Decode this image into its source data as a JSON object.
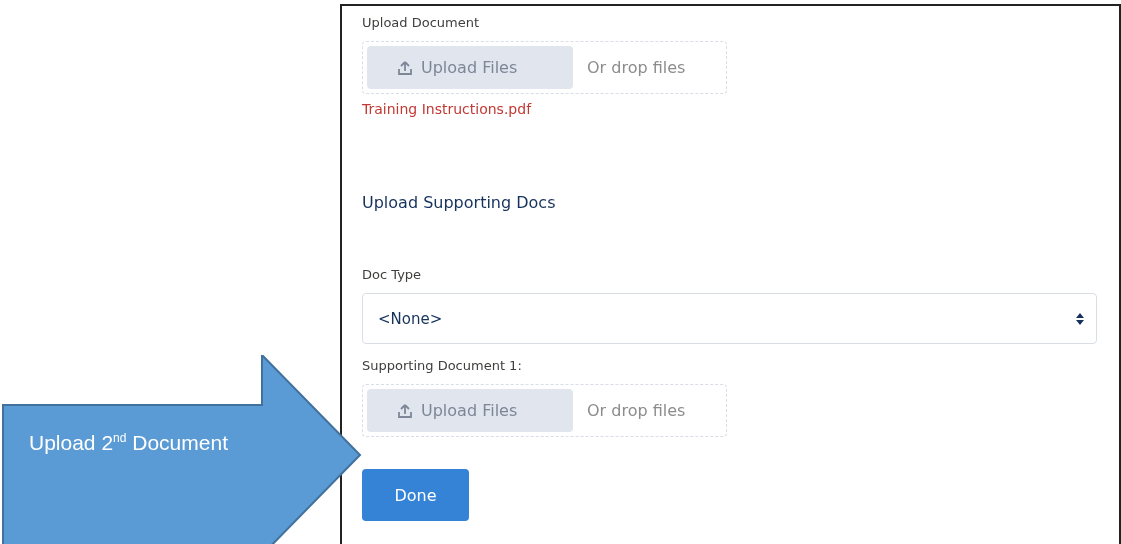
{
  "sections": [
    {
      "kind": "upload",
      "label": "Upload Document",
      "button": "Upload Files",
      "disabled": true,
      "drop_hint": "Or drop files",
      "files": [
        {
          "name": "Training Instructions.pdf"
        }
      ]
    },
    {
      "kind": "heading",
      "text": "Upload Supporting Docs"
    },
    {
      "kind": "select",
      "label": "Doc Type",
      "value": "<None>"
    },
    {
      "kind": "upload",
      "label": "Supporting Document 1:",
      "button": "Upload Files",
      "disabled": true,
      "drop_hint": "Or drop files"
    }
  ],
  "done_button": "Done",
  "callout": {
    "text": "Upload 2$^{nd}$ Document"
  }
}
